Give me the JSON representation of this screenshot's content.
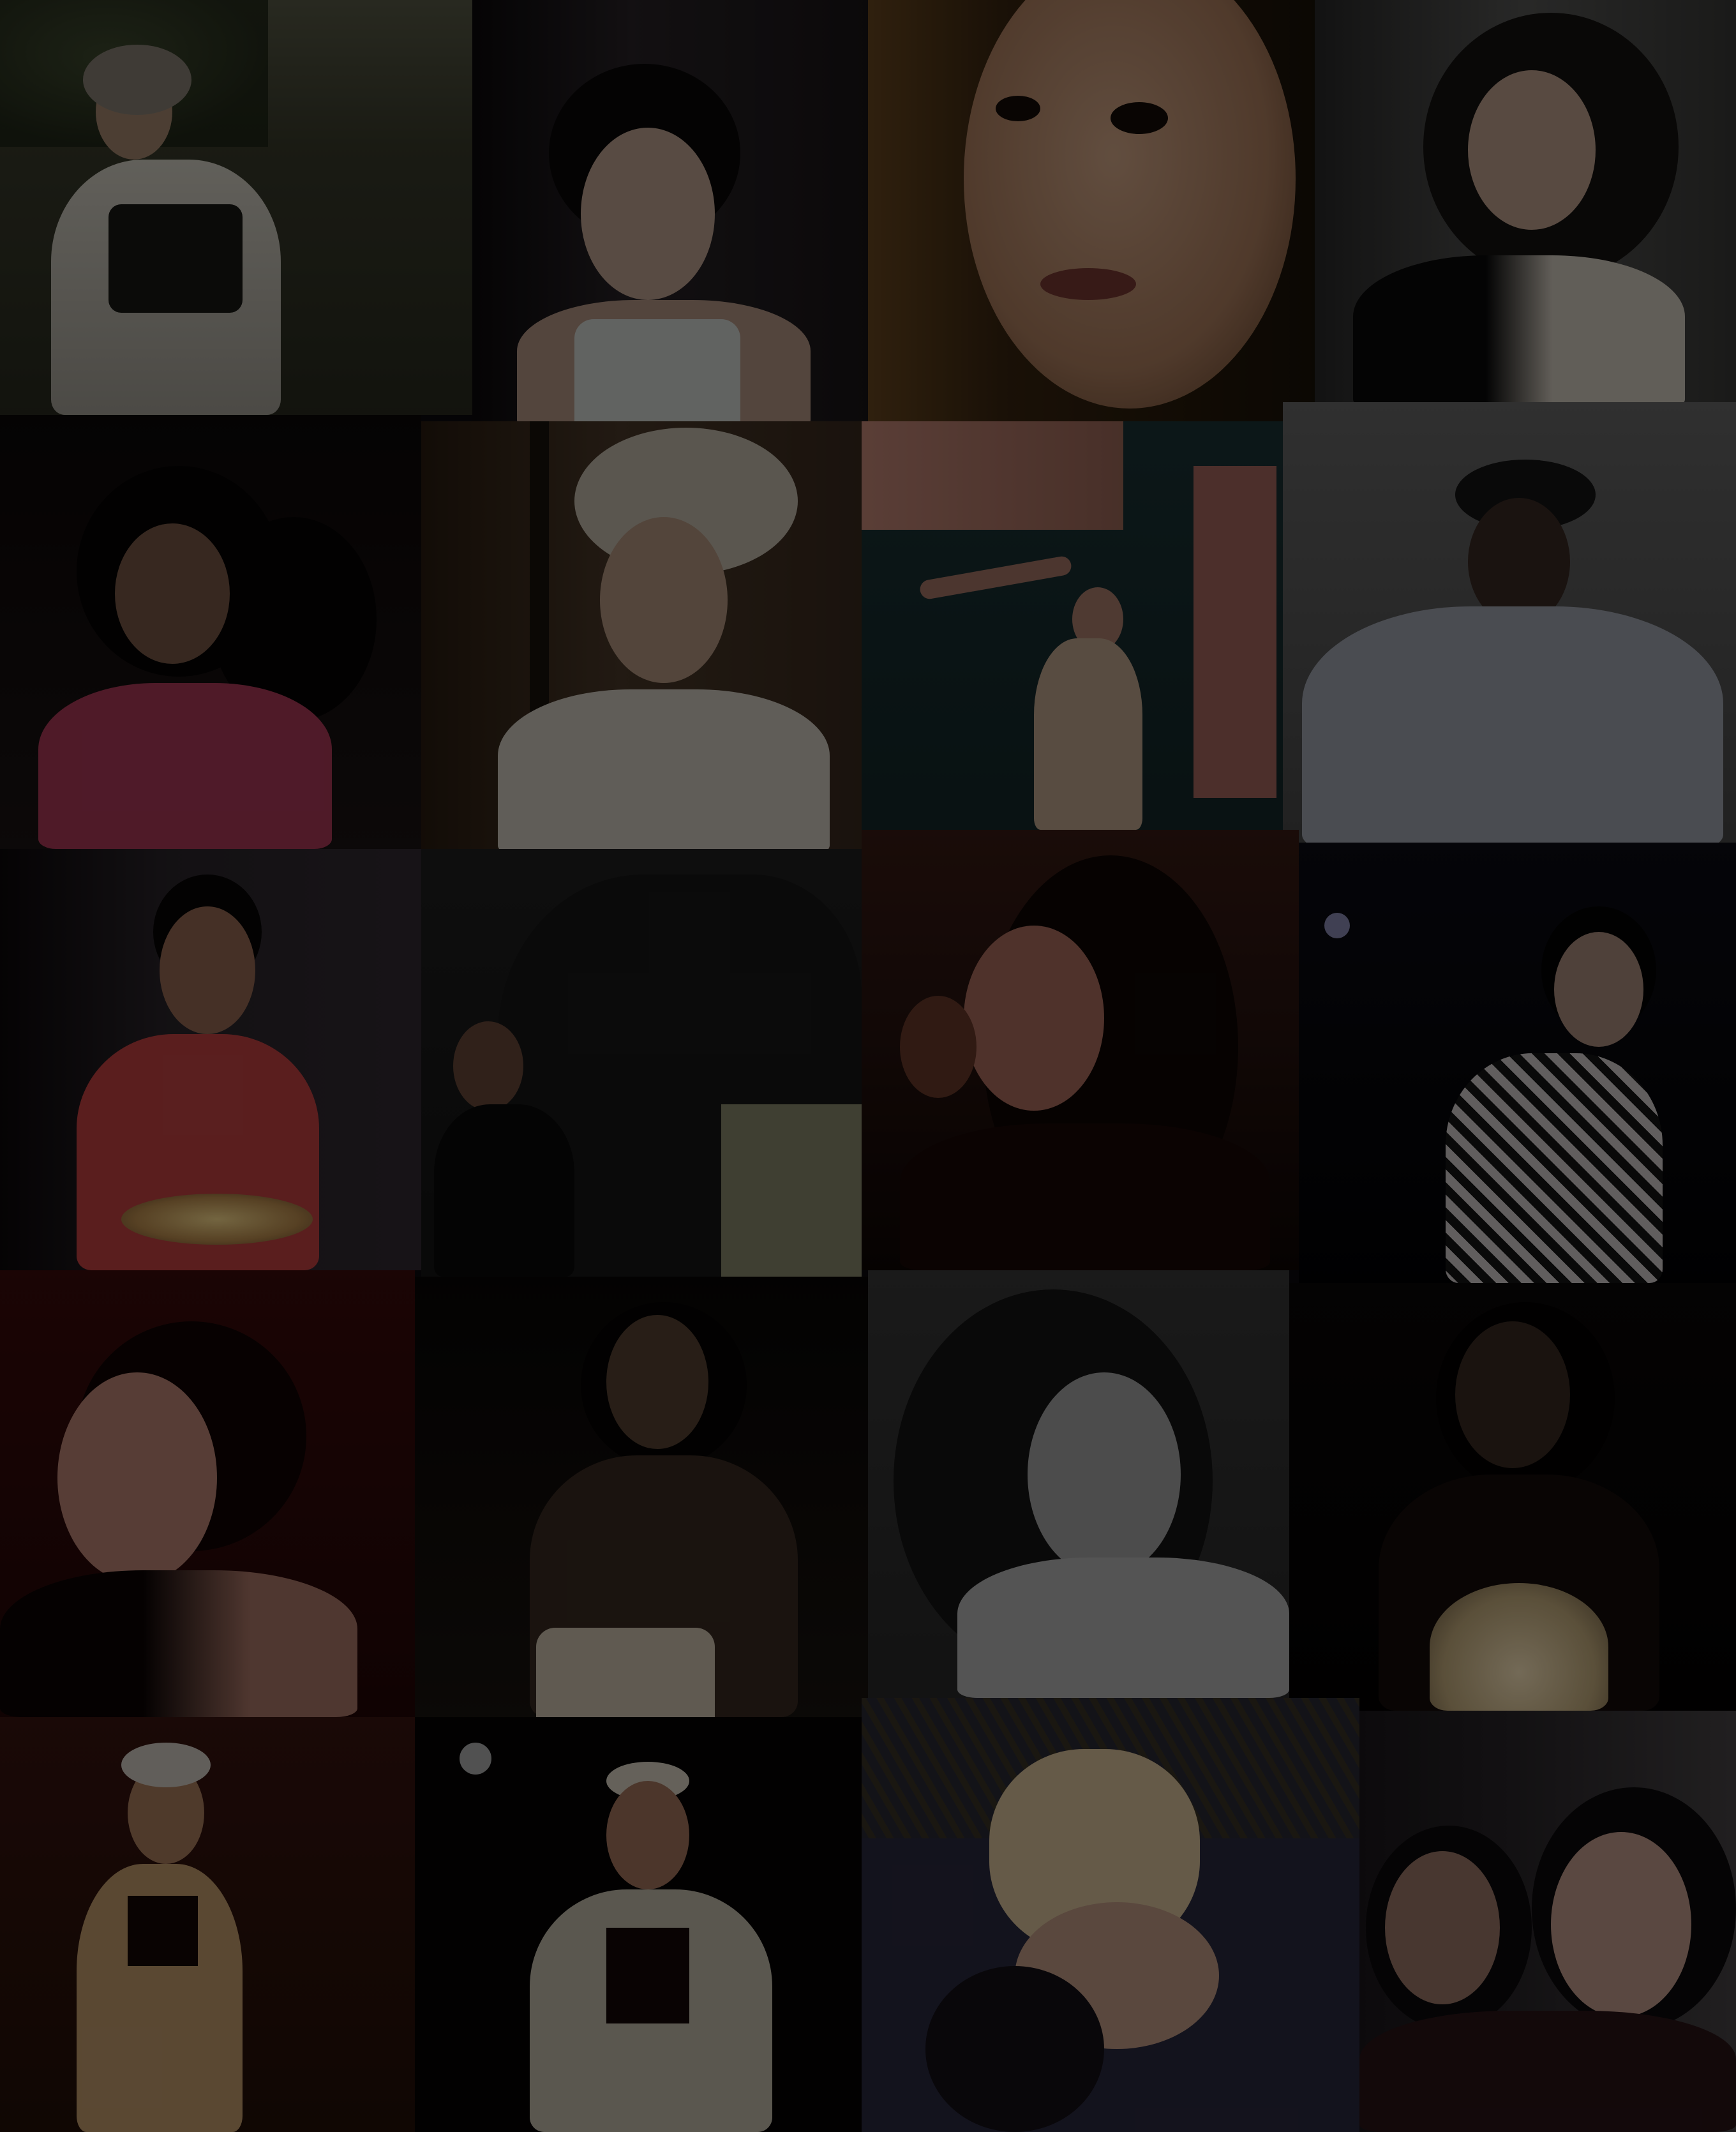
{
  "collage": {
    "description_free": true,
    "tiles": [
      {
        "id": "tile-1",
        "tones": [
          "#4a4a3a",
          "#2c2e22",
          "#c9c7bf"
        ],
        "subject": "woman-in-cap-garden"
      },
      {
        "id": "tile-2",
        "tones": [
          "#2a2428",
          "#0c0a0c",
          "#d8c3b3"
        ],
        "subject": "woman-portrait-dark-room"
      },
      {
        "id": "tile-3",
        "tones": [
          "#5a3a20",
          "#1a1208",
          "#c89a7c"
        ],
        "subject": "closeup-face"
      },
      {
        "id": "tile-4",
        "tones": [
          "#3c3c3c",
          "#0e0e0e",
          "#d4c8bc"
        ],
        "subject": "woman-curly-hair-bright"
      },
      {
        "id": "tile-5",
        "tones": [
          "#141010",
          "#060404",
          "#b43a5a"
        ],
        "subject": "woman-pink-top-shadow"
      },
      {
        "id": "tile-6",
        "tones": [
          "#4c3a2a",
          "#1a120c",
          "#cfc6ba"
        ],
        "subject": "woman-turban-portrait"
      },
      {
        "id": "tile-7",
        "tones": [
          "#1c3436",
          "#0a1416",
          "#c88a7a"
        ],
        "subject": "woman-dancing-blue-wall"
      },
      {
        "id": "tile-8",
        "tones": [
          "#545454",
          "#2a2a2a",
          "#a2a7b2"
        ],
        "subject": "man-in-cap-white-shirt"
      },
      {
        "id": "tile-9",
        "tones": [
          "#2c262c",
          "#0c080a",
          "#d04848"
        ],
        "subject": "woman-with-cake"
      },
      {
        "id": "tile-10",
        "tones": [
          "#1c1c1c",
          "#0a0a0a",
          "#8c8c70"
        ],
        "subject": "girl-with-elephant"
      },
      {
        "id": "tile-11",
        "tones": [
          "#3a1c14",
          "#0e0604",
          "#b07060"
        ],
        "subject": "woman-smiling-red-room"
      },
      {
        "id": "tile-12",
        "tones": [
          "#0c0c14",
          "#020204",
          "#d8d0d0"
        ],
        "subject": "woman-striped-jacket"
      },
      {
        "id": "tile-13",
        "tones": [
          "#3c0c0c",
          "#120404",
          "#c89080"
        ],
        "subject": "woman-red-sofa"
      },
      {
        "id": "tile-14",
        "tones": [
          "#1a1410",
          "#050403",
          "#d4c8b4"
        ],
        "subject": "woman-candle-dark"
      },
      {
        "id": "tile-15",
        "tones": [
          "#505050",
          "#1e1e1e",
          "#b8b8b8"
        ],
        "subject": "woman-bw-curly"
      },
      {
        "id": "tile-16",
        "tones": [
          "#0e0a0a",
          "#030202",
          "#e8d8b0"
        ],
        "subject": "woman-lamp-dark"
      },
      {
        "id": "tile-17",
        "tones": [
          "#3a1410",
          "#140604",
          "#d8b078"
        ],
        "subject": "woman-runway-red"
      },
      {
        "id": "tile-18",
        "tones": [
          "#0a0808",
          "#020202",
          "#d8d0c0"
        ],
        "subject": "woman-tiara-stage"
      },
      {
        "id": "tile-19",
        "tones": [
          "#2c2a36",
          "#14121c",
          "#e0c8a0"
        ],
        "subject": "girl-with-dog"
      },
      {
        "id": "tile-20",
        "tones": [
          "#242024",
          "#0c0a0c",
          "#c8a090"
        ],
        "subject": "two-women-selfie"
      }
    ]
  }
}
